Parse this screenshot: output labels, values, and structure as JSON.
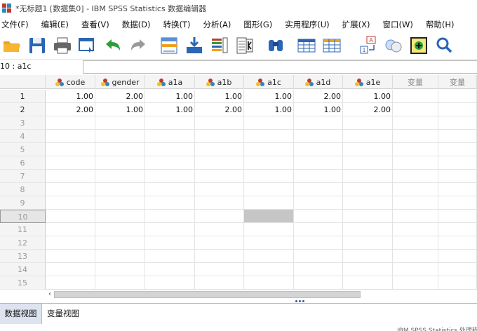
{
  "window": {
    "title": "*无标题1 [数据集0] - IBM SPSS Statistics 数据编辑器"
  },
  "menu": [
    "文件(F)",
    "编辑(E)",
    "查看(V)",
    "数据(D)",
    "转换(T)",
    "分析(A)",
    "图形(G)",
    "实用程序(U)",
    "扩展(X)",
    "窗口(W)",
    "帮助(H)"
  ],
  "toolbar": {
    "icons": [
      "open-folder-icon",
      "save-icon",
      "print-icon",
      "dialog-recall-icon",
      "undo-icon",
      "redo-icon",
      "goto-case-icon",
      "goto-variable-icon",
      "variables-icon",
      "run-descriptives-icon",
      "find-icon",
      "insert-cases-icon",
      "insert-variable-icon",
      "split-file-icon",
      "weight-cases-icon",
      "select-cases-icon",
      "value-labels-icon"
    ]
  },
  "cell_editor": {
    "reference": "10 : a1c",
    "value": ""
  },
  "columns": [
    "code",
    "gender",
    "a1a",
    "a1b",
    "a1c",
    "a1d",
    "a1e"
  ],
  "empty_columns": [
    "变量",
    "变量"
  ],
  "row_numbers": [
    "1",
    "2",
    "3",
    "4",
    "5",
    "6",
    "7",
    "8",
    "9",
    "10",
    "11",
    "12",
    "13",
    "14",
    "15"
  ],
  "rows": [
    [
      "1.00",
      "2.00",
      "1.00",
      "1.00",
      "1.00",
      "2.00",
      "1.00"
    ],
    [
      "2.00",
      "1.00",
      "1.00",
      "2.00",
      "1.00",
      "1.00",
      "2.00"
    ]
  ],
  "selection": {
    "row": "10",
    "column": "a1c"
  },
  "scroll": {
    "left_arrow": "‹"
  },
  "tabs": [
    "数据视图",
    "变量视图"
  ],
  "active_tab": "数据视图",
  "status": {
    "text": "IBM SPSS Statistics 处理程序就绪"
  },
  "colors": {
    "accent": "#2f5aa8",
    "selected_cell": "#c6c6c6",
    "header_bg": "#f4f4f4"
  }
}
